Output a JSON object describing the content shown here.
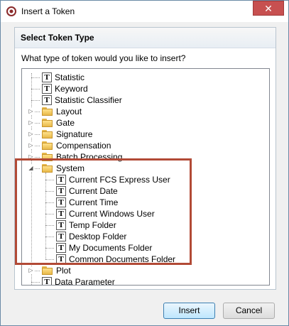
{
  "window": {
    "title": "Insert a Token",
    "close_glyph": "✕"
  },
  "group": {
    "title": "Select Token Type"
  },
  "question": "What type of token would you like to insert?",
  "tree": [
    {
      "label": "Statistic",
      "kind": "token",
      "level": 1,
      "expander": ""
    },
    {
      "label": "Keyword",
      "kind": "token",
      "level": 1,
      "expander": ""
    },
    {
      "label": "Statistic Classifier",
      "kind": "token",
      "level": 1,
      "expander": ""
    },
    {
      "label": "Layout",
      "kind": "folder",
      "level": 1,
      "expander": "collapsed"
    },
    {
      "label": "Gate",
      "kind": "folder",
      "level": 1,
      "expander": "collapsed"
    },
    {
      "label": "Signature",
      "kind": "folder",
      "level": 1,
      "expander": "collapsed"
    },
    {
      "label": "Compensation",
      "kind": "folder",
      "level": 1,
      "expander": "collapsed"
    },
    {
      "label": "Batch Processing",
      "kind": "folder",
      "level": 1,
      "expander": "collapsed"
    },
    {
      "label": "System",
      "kind": "folder",
      "level": 1,
      "expander": "expanded"
    },
    {
      "label": "Current FCS Express User",
      "kind": "token",
      "level": 2,
      "expander": ""
    },
    {
      "label": "Current Date",
      "kind": "token",
      "level": 2,
      "expander": ""
    },
    {
      "label": "Current Time",
      "kind": "token",
      "level": 2,
      "expander": ""
    },
    {
      "label": "Current Windows User",
      "kind": "token",
      "level": 2,
      "expander": ""
    },
    {
      "label": "Temp Folder",
      "kind": "token",
      "level": 2,
      "expander": ""
    },
    {
      "label": "Desktop Folder",
      "kind": "token",
      "level": 2,
      "expander": ""
    },
    {
      "label": "My Documents Folder",
      "kind": "token",
      "level": 2,
      "expander": ""
    },
    {
      "label": "Common Documents Folder",
      "kind": "token",
      "level": 2,
      "expander": ""
    },
    {
      "label": "Plot",
      "kind": "folder",
      "level": 1,
      "expander": "collapsed"
    },
    {
      "label": "Data Parameter",
      "kind": "token",
      "level": 1,
      "expander": ""
    }
  ],
  "icons": {
    "token": "T",
    "expander_collapsed": "▷",
    "expander_expanded": "◢"
  },
  "buttons": {
    "insert": "Insert",
    "cancel": "Cancel"
  },
  "colors": {
    "highlight": "#b24a36",
    "close": "#c75050"
  }
}
